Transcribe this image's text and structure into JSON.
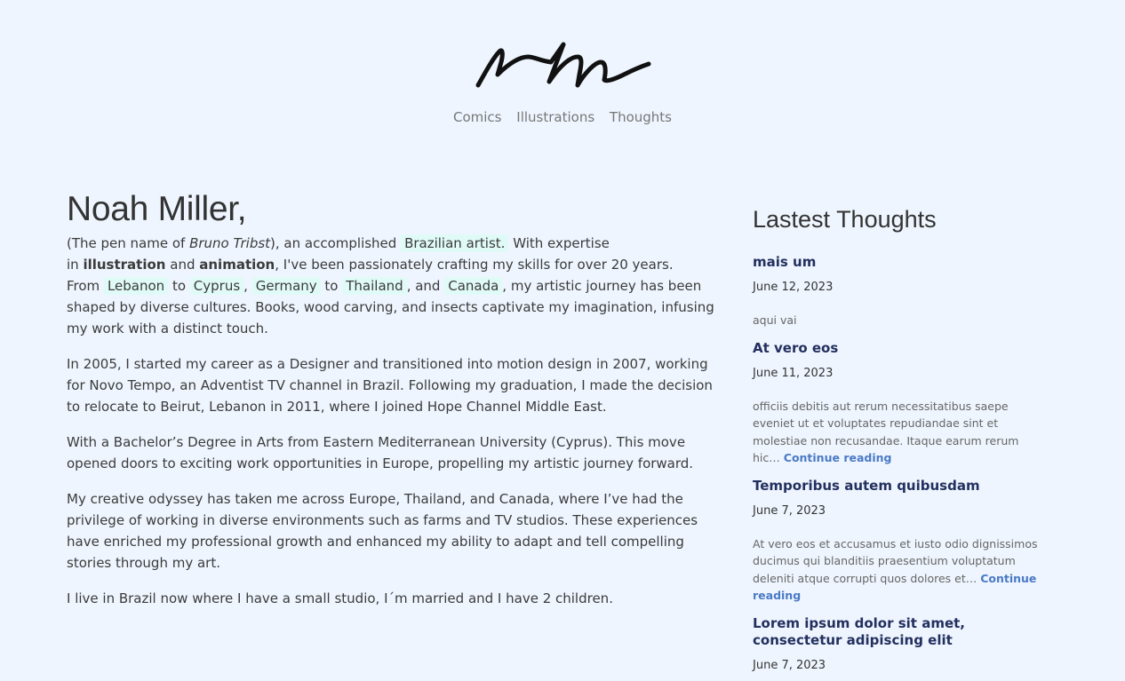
{
  "nav": {
    "items": [
      "Comics",
      "Illustrations",
      "Thoughts"
    ]
  },
  "about": {
    "name": "Noah Miller,",
    "intro": {
      "t1": "(The pen name of ",
      "penname": "Bruno Tribst",
      "t2": "), an accomplished ",
      "brazilian": "Brazilian artist.",
      "t3": " With expertise",
      "t4": "in ",
      "illustration": "illustration",
      "and": " and ",
      "animation": "animation",
      "t5": ", I've been passionately crafting my skills for over 20 years.",
      "from": "From ",
      "lebanon": "Lebanon",
      "to1": " to ",
      "cyprus": "Cyprus",
      "comma1": ", ",
      "germany": "Germany",
      "to2": " to ",
      "thailand": "Thailand",
      "andc": ", and ",
      "canada": "Canada",
      "t6": ", my artistic journey has been shaped by diverse cultures. Books, wood carving, and insects captivate my imagination, infusing my work with a distinct touch."
    },
    "paragraphs": [
      "In 2005, I started my career as a Designer and transitioned into motion design in 2007, working for Novo Tempo, an Adventist TV channel in Brazil. Following my graduation, I made the decision to relocate to Beirut, Lebanon in 2011, where I joined Hope Channel Middle East.",
      "With a Bachelor’s Degree in Arts from Eastern Mediterranean University (Cyprus). This move opened doors to exciting work opportunities in Europe, propelling my artistic journey forward.",
      "My creative odyssey has taken me across Europe, Thailand, and Canada, where I’ve had the privilege of working in diverse environments such as farms and TV studios. These experiences have enriched my professional growth and enhanced my ability to adapt and tell compelling stories through my art.",
      "I live in Brazil now where I have a small studio, I´m married and I have 2 children."
    ]
  },
  "sidebar": {
    "title": "Lastest Thoughts",
    "continue_label": "Continue reading",
    "posts": [
      {
        "title": "mais um",
        "date": "June 12, 2023",
        "excerpt": "aqui vai"
      },
      {
        "title": "At vero eos",
        "date": "June 11, 2023",
        "excerpt": "officiis debitis aut rerum necessitatibus saepe eveniet ut et voluptates repudiandae sint et molestiae non recusandae. Itaque earum rerum hic…"
      },
      {
        "title": "Temporibus autem quibusdam",
        "date": "June 7, 2023",
        "excerpt": "At vero eos et accusamus et iusto odio dignissimos ducimus qui blanditiis praesentium voluptatum deleniti atque corrupti quos dolores et…"
      },
      {
        "title": "Lorem ipsum dolor sit amet, consectetur adipiscing elit",
        "date": "June 7, 2023"
      }
    ]
  },
  "colors": {
    "background": "#eef5fe",
    "highlight": "#e0fbf7",
    "link": "#4a7ac7",
    "post_title": "#23305f"
  }
}
